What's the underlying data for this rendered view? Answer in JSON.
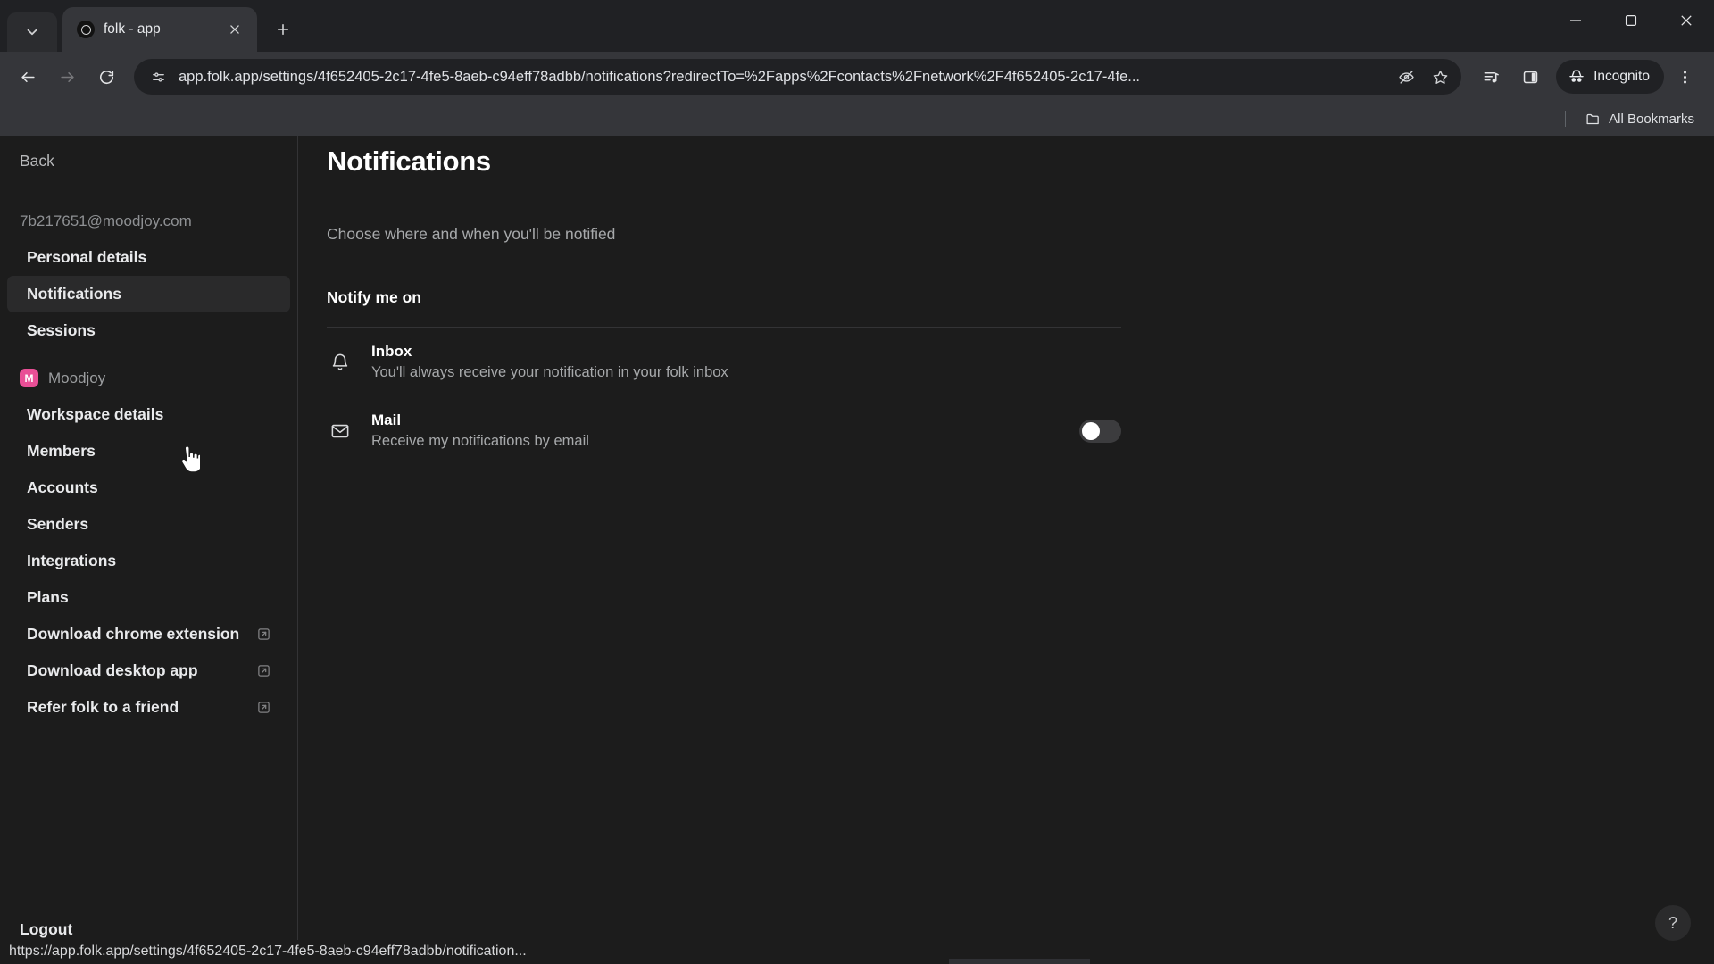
{
  "browser": {
    "tab": {
      "title": "folk - app",
      "favicon_name": "folk-logo"
    },
    "new_tab_label": "+",
    "window_controls": {
      "minimize": "minimize",
      "maximize": "maximize",
      "close": "close"
    },
    "omnibox": {
      "url": "app.folk.app/settings/4f652405-2c17-4fe5-8aeb-c94eff78adbb/notifications?redirectTo=%2Fapps%2Fcontacts%2Fnetwork%2F4f652405-2c17-4fe...",
      "site_info_icon": "tune-icon",
      "tracking_icon": "eye-off-icon",
      "bookmark_icon": "star-icon"
    },
    "toolbar": {
      "back": "back-arrow",
      "forward": "forward-arrow",
      "reload": "reload",
      "media_icon": "media-playlist-icon",
      "side_panel_icon": "side-panel-icon",
      "incognito_label": "Incognito",
      "menu_icon": "three-dot-menu"
    },
    "bookmarks_bar": {
      "all_bookmarks_label": "All Bookmarks"
    },
    "status_bar": {
      "url": "https://app.folk.app/settings/4f652405-2c17-4fe5-8aeb-c94eff78adbb/notification..."
    }
  },
  "sidebar": {
    "back_label": "Back",
    "account_email": "7b217651@moodjoy.com",
    "account_items": [
      {
        "label": "Personal details",
        "active": false,
        "external": false
      },
      {
        "label": "Notifications",
        "active": true,
        "external": false
      },
      {
        "label": "Sessions",
        "active": false,
        "external": false
      }
    ],
    "workspace": {
      "badge_letter": "M",
      "name": "Moodjoy",
      "badge_color": "#e94f96"
    },
    "workspace_items": [
      {
        "label": "Workspace details",
        "active": false,
        "external": false
      },
      {
        "label": "Members",
        "active": false,
        "external": false
      },
      {
        "label": "Accounts",
        "active": false,
        "external": false
      },
      {
        "label": "Senders",
        "active": false,
        "external": false
      },
      {
        "label": "Integrations",
        "active": false,
        "external": false
      },
      {
        "label": "Plans",
        "active": false,
        "external": false
      },
      {
        "label": "Download chrome extension",
        "active": false,
        "external": true
      },
      {
        "label": "Download desktop app",
        "active": false,
        "external": true
      },
      {
        "label": "Refer folk to a friend",
        "active": false,
        "external": true
      }
    ],
    "logout_label": "Logout"
  },
  "main": {
    "title": "Notifications",
    "subtitle": "Choose where and when you'll be notified",
    "section_title": "Notify me on",
    "rows": [
      {
        "icon": "bell-icon",
        "title": "Inbox",
        "description": "You'll always receive your notification in your folk inbox",
        "has_toggle": false,
        "toggle_on": false
      },
      {
        "icon": "mail-icon",
        "title": "Mail",
        "description": "Receive my notifications by email",
        "has_toggle": true,
        "toggle_on": false
      }
    ],
    "help_label": "?"
  }
}
